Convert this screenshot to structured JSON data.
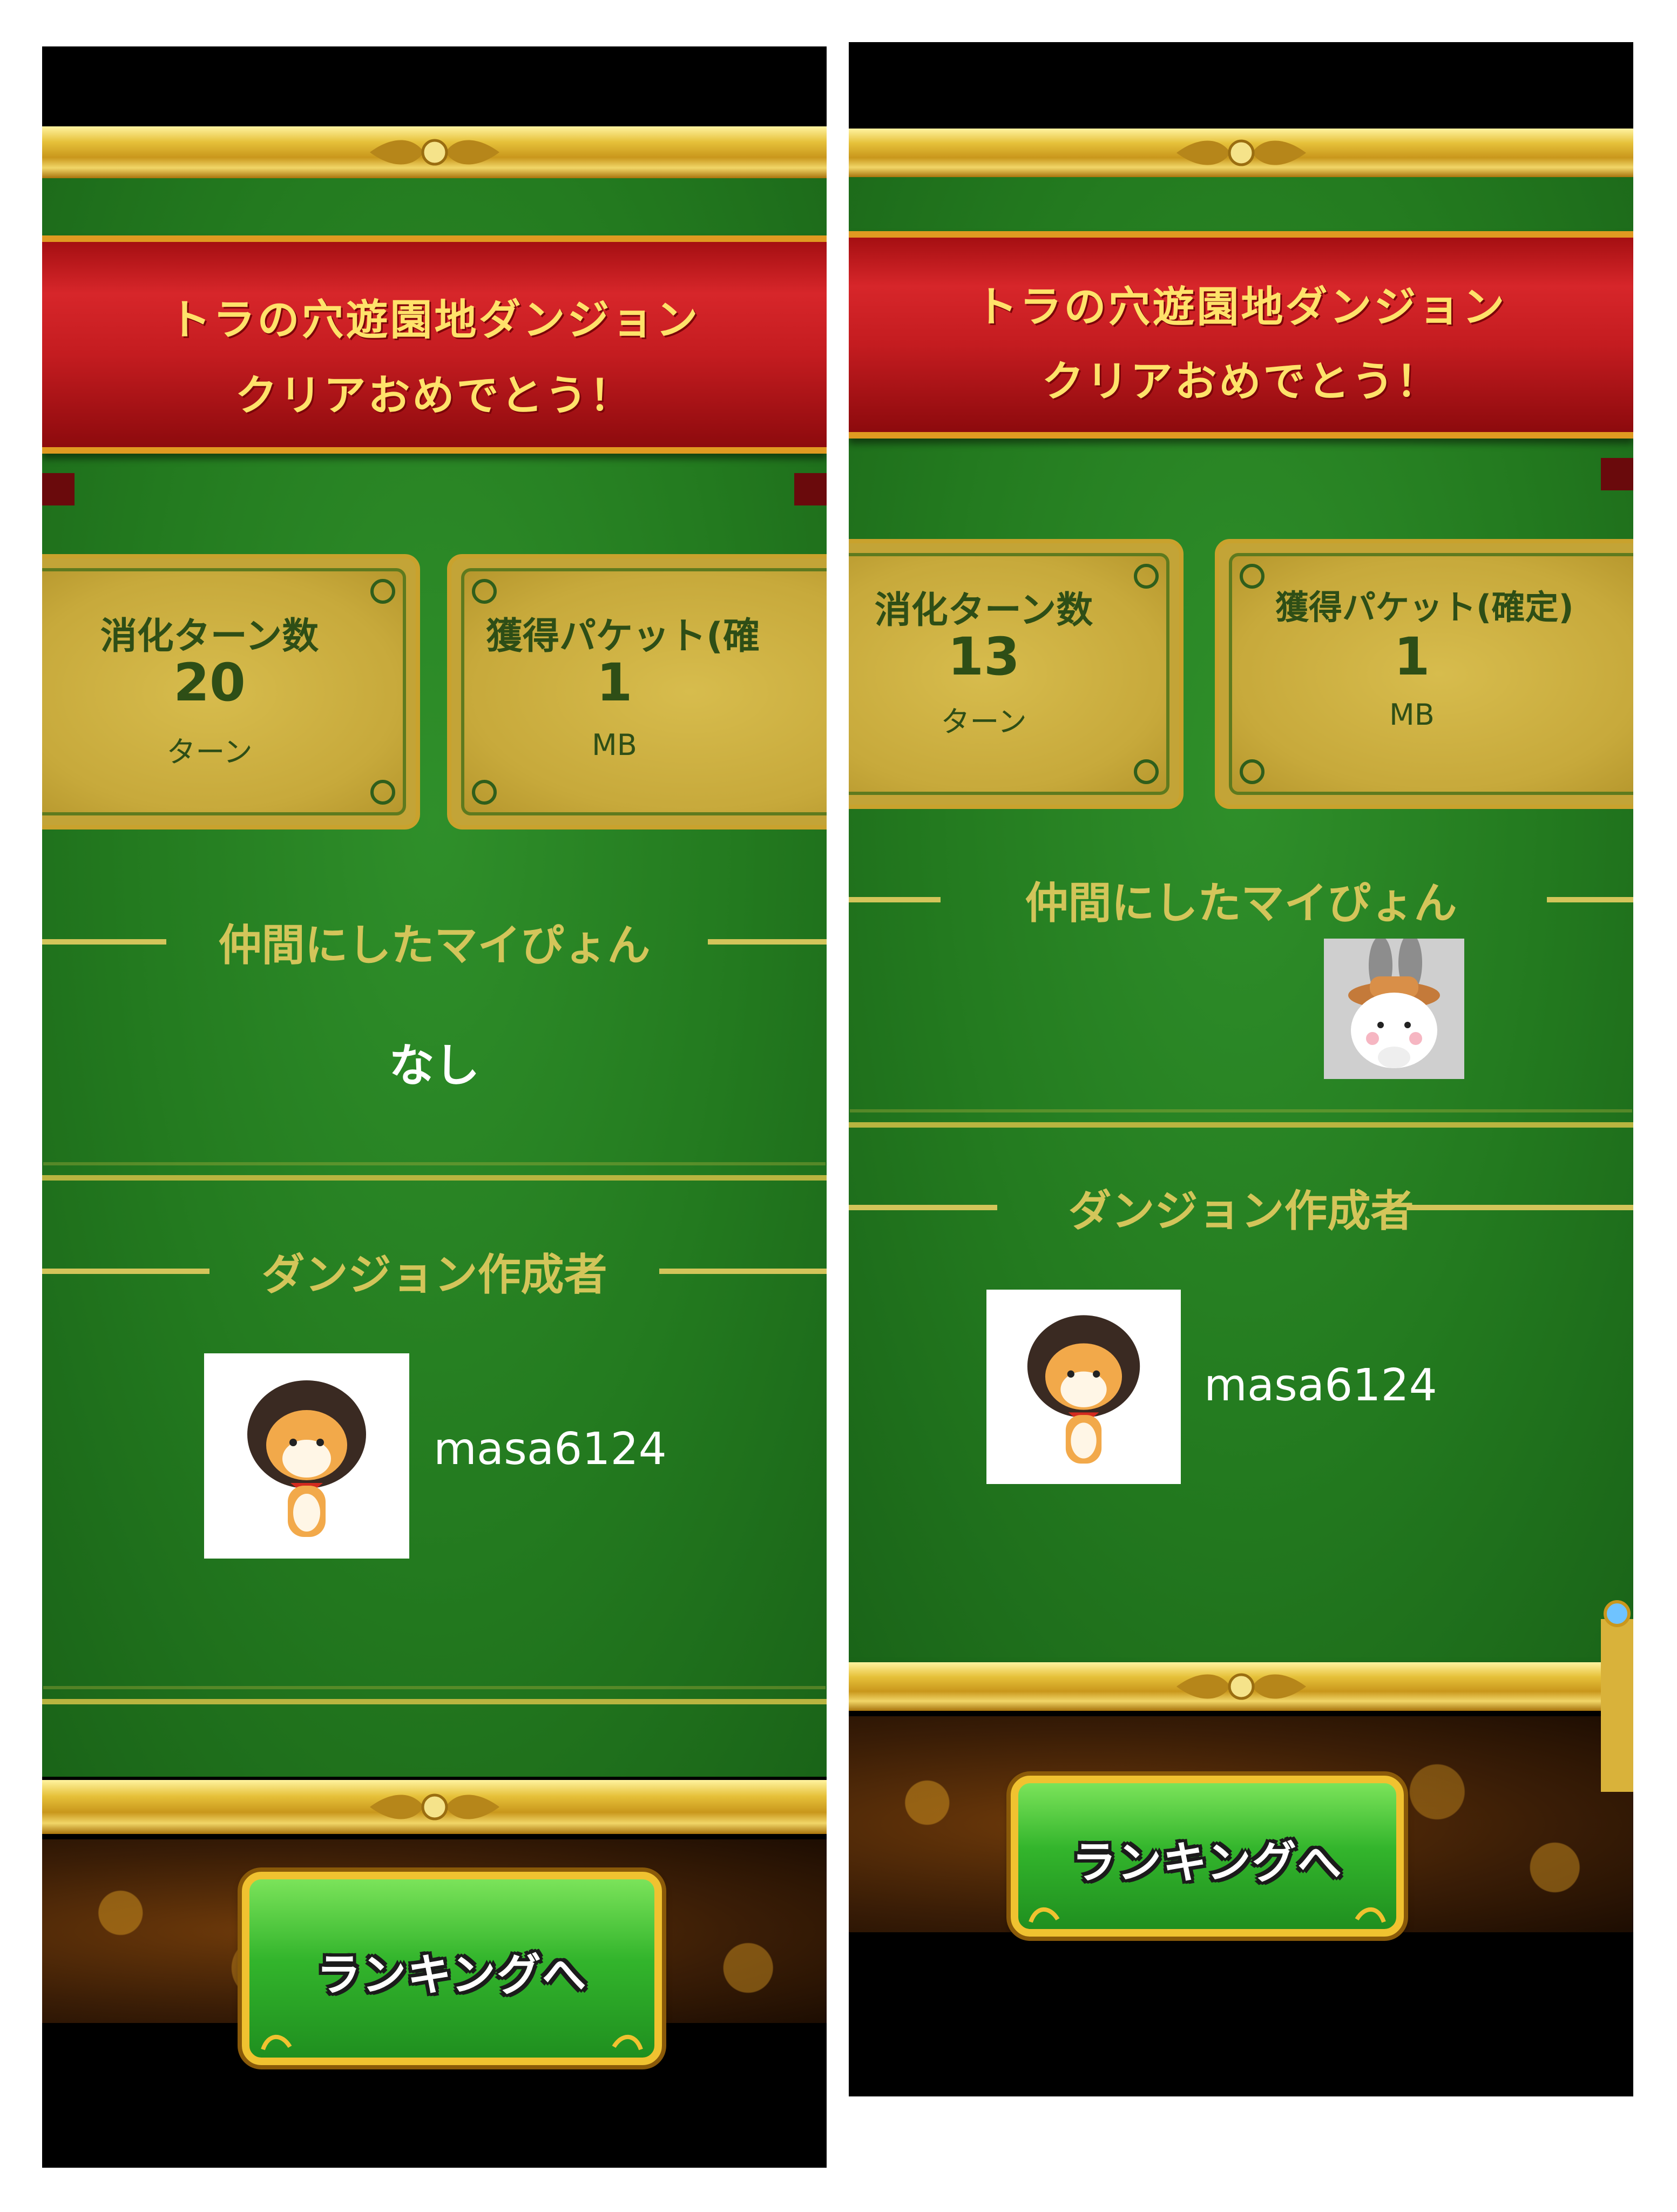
{
  "left": {
    "banner": {
      "line1": "トラの穴遊園地ダンジョン",
      "line2": "クリアおめでとう！"
    },
    "stats": {
      "turns": {
        "label": "消化ターン数",
        "value": "20",
        "unit": "ターン"
      },
      "packets": {
        "label": "獲得パケット(確",
        "value": "1",
        "unit": "MB"
      }
    },
    "recruited": {
      "heading": "仲間にしたマイぴょん",
      "none_text": "なし"
    },
    "creator": {
      "heading": "ダンジョン作成者",
      "name": "masa6124"
    },
    "ranking_button": "ランキングへ"
  },
  "right": {
    "banner": {
      "line1": "トラの穴遊園地ダンジョン",
      "line2": "クリアおめでとう！"
    },
    "stats": {
      "turns": {
        "label": "消化ターン数",
        "value": "13",
        "unit": "ターン"
      },
      "packets": {
        "label": "獲得パケット(確定)",
        "value": "1",
        "unit": "MB"
      }
    },
    "recruited": {
      "heading": "仲間にしたマイぴょん",
      "icon": "bunny-explorer-icon"
    },
    "creator": {
      "heading": "ダンジョン作成者",
      "name": "masa6124"
    },
    "ranking_button": "ランキングへ"
  },
  "colors": {
    "felt": "#237a1f",
    "gold": "#e6c13a",
    "banner_red": "#c41c20",
    "banner_text": "#ffe26a",
    "heading_text": "#d3c55a",
    "button_green": "#33b52c"
  }
}
